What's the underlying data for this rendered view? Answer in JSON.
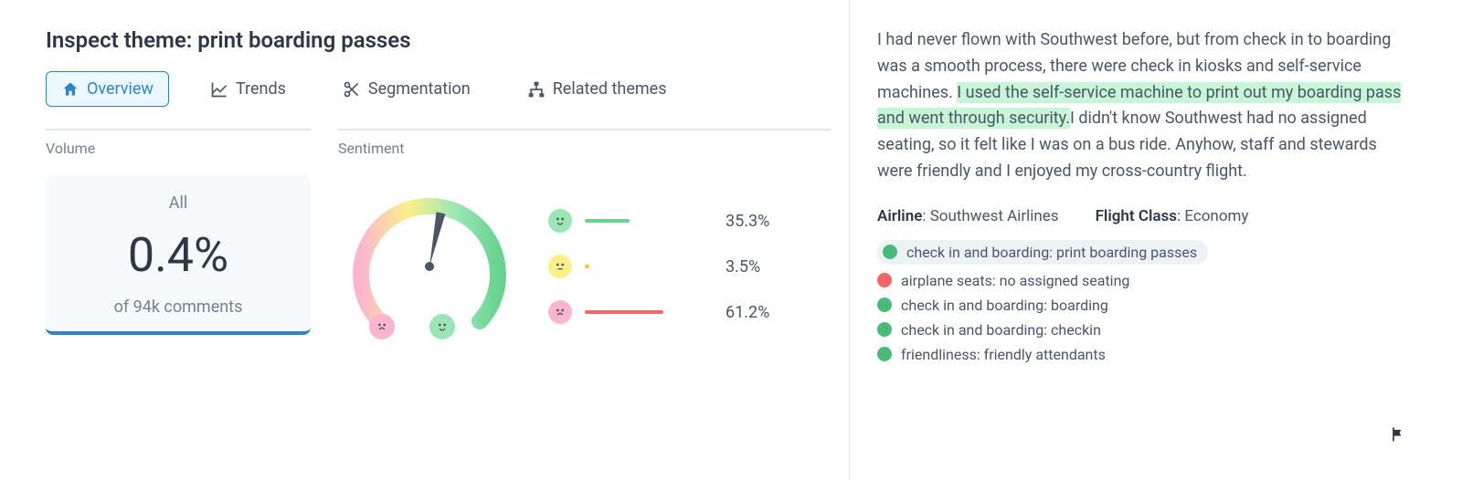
{
  "title": "Inspect theme: print boarding passes",
  "tabs": [
    {
      "label": "Overview",
      "icon": "home-icon",
      "active": true
    },
    {
      "label": "Trends",
      "icon": "chart-icon",
      "active": false
    },
    {
      "label": "Segmentation",
      "icon": "scissors-icon",
      "active": false
    },
    {
      "label": "Related themes",
      "icon": "sitemap-icon",
      "active": false
    }
  ],
  "volume": {
    "header": "Volume",
    "label": "All",
    "value": "0.4%",
    "sub": "of 94k comments"
  },
  "sentiment": {
    "header": "Sentiment",
    "positive": {
      "percent": 35.3,
      "label": "35.3%"
    },
    "neutral": {
      "percent": 3.5,
      "label": "3.5%"
    },
    "negative": {
      "percent": 61.2,
      "label": "61.2%"
    }
  },
  "comment": {
    "pre": "I had never flown with Southwest before, but from check in to boarding was a smooth process, there were check in kiosks and self-service machines. ",
    "highlight": "I used the self-service machine to print out my boarding pass and went through security.",
    "post": "I didn't know Southwest had no assigned seating, so it felt like I was on a bus ride. Anyhow, staff and stewards were friendly and I enjoyed my cross-country flight."
  },
  "meta": {
    "airline_label": "Airline",
    "airline_value": "Southwest Airlines",
    "class_label": "Flight Class",
    "class_value": "Economy"
  },
  "tags": [
    {
      "sentiment": "green",
      "label": "check in and boarding: print boarding passes",
      "pill": true
    },
    {
      "sentiment": "red",
      "label": "airplane seats: no assigned seating",
      "pill": false
    },
    {
      "sentiment": "green",
      "label": "check in and boarding: boarding",
      "pill": false
    },
    {
      "sentiment": "green",
      "label": "check in and boarding: checkin",
      "pill": false
    },
    {
      "sentiment": "green",
      "label": "friendliness: friendly attendants",
      "pill": false
    }
  ],
  "chart_data": {
    "type": "pie",
    "title": "Sentiment",
    "categories": [
      "Positive",
      "Neutral",
      "Negative"
    ],
    "values": [
      35.3,
      3.5,
      61.2
    ],
    "colors": [
      "#68d391",
      "#ecc94b",
      "#f56565"
    ]
  }
}
